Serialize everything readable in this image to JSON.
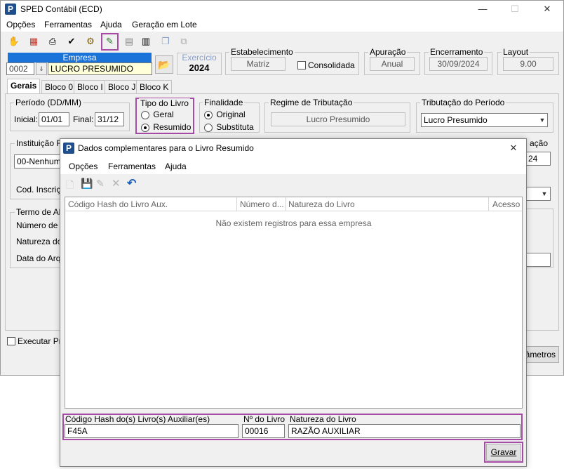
{
  "window": {
    "title": "SPED Contábil (ECD)",
    "controls": {
      "minimize": "—",
      "maximize": "☐",
      "close": "✕"
    }
  },
  "menu": [
    "Opções",
    "Ferramentas",
    "Ajuda",
    "Geração em Lote"
  ],
  "empresa": {
    "label": "Empresa",
    "code": "0002",
    "name": "LUCRO PRESUMIDO"
  },
  "exercicio": {
    "label": "Exercício",
    "value": "2024"
  },
  "estabelecimento": {
    "label": "Estabelecimento",
    "value": "Matriz",
    "consolidada_label": "Consolidada"
  },
  "apuracao": {
    "label": "Apuração",
    "value": "Anual"
  },
  "encerramento": {
    "label": "Encerramento",
    "value": "30/09/2024"
  },
  "layout": {
    "label": "Layout",
    "value": "9.00"
  },
  "tabs": [
    "Gerais",
    "Bloco 0",
    "Bloco I",
    "Bloco J",
    "Bloco K"
  ],
  "periodo": {
    "label": "Período (DD/MM)",
    "inicial_label": "Inicial:",
    "inicial": "01/01",
    "final_label": "Final:",
    "final": "31/12"
  },
  "tipo_livro": {
    "label": "Tipo do Livro",
    "options": [
      "Geral",
      "Resumido"
    ],
    "selected": "Resumido"
  },
  "finalidade": {
    "label": "Finalidade",
    "options": [
      "Original",
      "Substituta"
    ],
    "selected": "Original"
  },
  "regime": {
    "label": "Regime de Tributação",
    "value": "Lucro Presumido"
  },
  "tributacao_periodo": {
    "label": "Tributação do Período",
    "value": "Lucro Presumido"
  },
  "background_form": {
    "instituicao_label": "Instituição Re",
    "instituicao_value": "00-Nenhuma",
    "cod_inscricao_label": "Cod. Inscriçã",
    "termo_label": "Termo de Abe",
    "numero_label": "Número de O",
    "natureza_label": "Natureza do",
    "data_label": "Data do Arqu",
    "right_partial_label": "ação",
    "right_partial_value": "24",
    "executar_label": "Executar Pré",
    "parametros_label": "âmetros"
  },
  "dialog": {
    "title": "Dados complementares para o Livro Resumido",
    "close": "✕",
    "menu": [
      "Opções",
      "Ferramentas",
      "Ajuda"
    ],
    "grid": {
      "columns": [
        "Código Hash do Livro Aux.",
        "Número d...",
        "Natureza do Livro",
        "Acesso"
      ],
      "empty_message": "Não existem registros para essa empresa"
    },
    "form": {
      "hash_label": "Código Hash do(s) Livro(s) Auxiliar(es)",
      "hash_value": "F45A",
      "numero_label": "Nº do Livro",
      "numero_value": "00016",
      "natureza_label": "Natureza do Livro",
      "natureza_value": "RAZÃO AUXILIAR"
    },
    "gravar_label": "Gravar"
  }
}
